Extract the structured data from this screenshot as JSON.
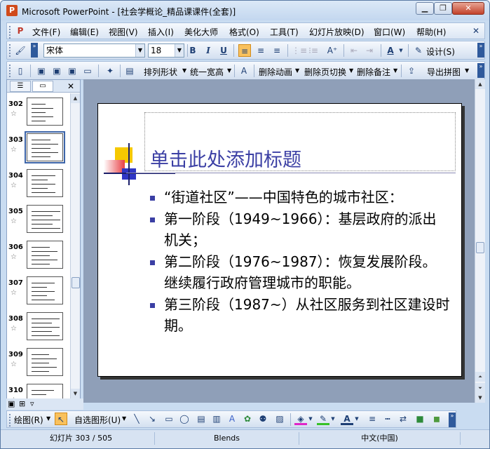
{
  "window": {
    "title": "Microsoft PowerPoint - [社会学概论_精品课课件(全套)]",
    "app_icon_letter": "P",
    "min_label": "▭",
    "restore_label": "❐",
    "close_label": "✕"
  },
  "menu": {
    "doc_icon": "P",
    "items": [
      "文件(F)",
      "编辑(E)",
      "视图(V)",
      "插入(I)",
      "美化大师",
      "格式(O)",
      "工具(T)",
      "幻灯片放映(D)",
      "窗口(W)",
      "帮助(H)"
    ]
  },
  "format_toolbar": {
    "font_name": "宋体",
    "font_size": "18",
    "bold": "B",
    "italic": "I",
    "underline": "U",
    "design_label": "设计(S)"
  },
  "drawing_toolbar2": {
    "arrange": "排列形状",
    "unify": "统一宽高",
    "delete_anim": "删除动画",
    "delete_trans": "删除页切换",
    "delete_notes": "删除备注",
    "export": "导出拼图"
  },
  "slide_pane": {
    "thumbnails": [
      {
        "num": "302",
        "star": "☆"
      },
      {
        "num": "303",
        "star": "☆"
      },
      {
        "num": "304",
        "star": "☆"
      },
      {
        "num": "305",
        "star": "☆"
      },
      {
        "num": "306",
        "star": "☆"
      },
      {
        "num": "307",
        "star": "☆"
      },
      {
        "num": "308",
        "star": "☆"
      },
      {
        "num": "309",
        "star": "☆"
      },
      {
        "num": "310",
        "star": "☆"
      }
    ],
    "selected_index": 1
  },
  "slide": {
    "title": "单击此处添加标题",
    "bullets": [
      "“街道社区”——中国特色的城市社区：",
      "第一阶段（1949~1966）：基层政府的派出机关；",
      "第二阶段（1976~1987）：恢复发展阶段。继续履行政府管理城市的职能。",
      "第三阶段（1987~）从社区服务到社区建设时期。"
    ],
    "title_color": "#3b3fa4",
    "bullet_color": "#3b3fa4"
  },
  "draw_toolbar": {
    "draw_label": "绘图(R)",
    "autoshape_label": "自选图形(U)"
  },
  "status": {
    "slide_info": "幻灯片 303 / 505",
    "template": "Blends",
    "language": "中文(中国)"
  }
}
